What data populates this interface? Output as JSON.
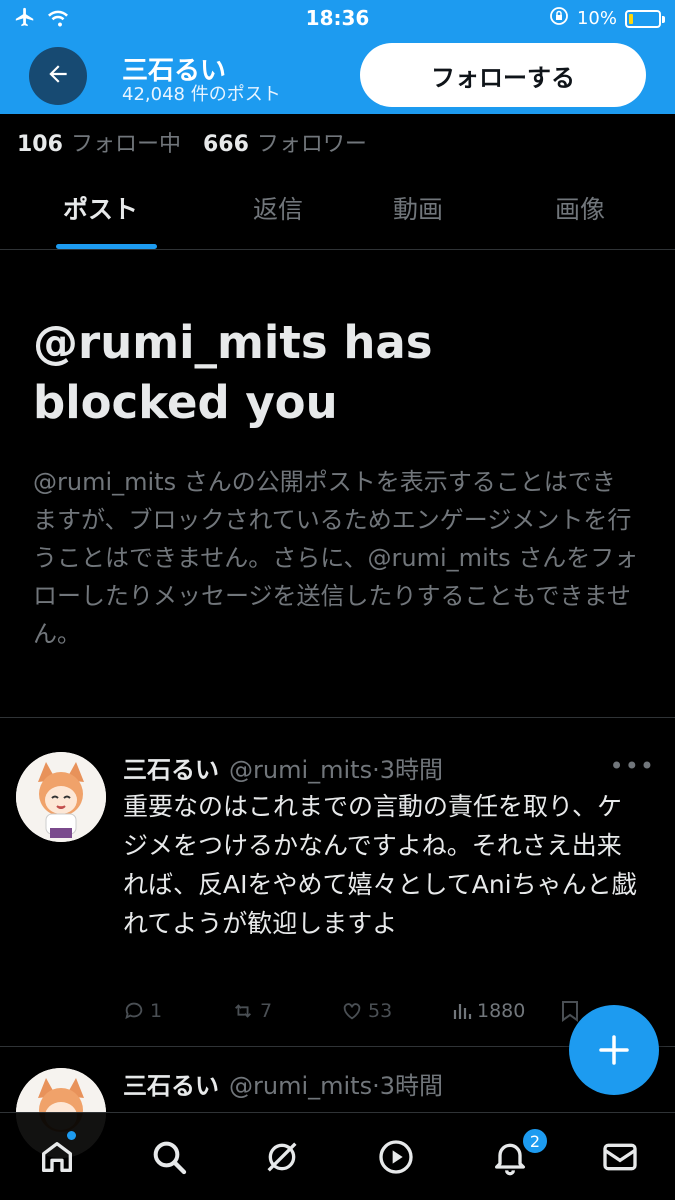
{
  "status_bar": {
    "time": "18:36",
    "battery": "10%",
    "battery_level": 0.1
  },
  "header": {
    "name": "三石るい",
    "post_count": "42,048 件のポスト",
    "follow_label": "フォローする"
  },
  "stats": {
    "following_count": "106",
    "following_label": "フォロー中",
    "followers_count": "666",
    "followers_label": "フォロワー"
  },
  "tabs": [
    {
      "label": "ポスト",
      "active": true
    },
    {
      "label": "返信",
      "active": false
    },
    {
      "label": "動画",
      "active": false
    },
    {
      "label": "画像",
      "active": false
    }
  ],
  "blocked": {
    "title": "@rumi_mits has blocked you",
    "description": "@rumi_mits さんの公開ポストを表示することはできますが、ブロックされているためエンゲージメントを行うことはできません。さらに、@rumi_mits さんをフォローしたりメッセージを送信したりすることもできません。"
  },
  "posts": [
    {
      "name": "三石るい",
      "handle": "@rumi_mits",
      "time": "3時間",
      "text": "重要なのはこれまでの言動の責任を取り、ケジメをつけるかなんですよね。それさえ出来れば、反AIをやめて嬉々としてAniちゃんと戯れてようが歓迎しますよ",
      "replies": "1",
      "reposts": "7",
      "likes": "53",
      "views": "1880"
    },
    {
      "name": "三石るい",
      "handle": "@rumi_mits",
      "time": "3時間"
    }
  ],
  "nav": {
    "notifications_badge": "2"
  },
  "colors": {
    "accent": "#1d9bf0",
    "background": "#000000",
    "text_primary": "#e7e9ea",
    "text_secondary": "#71767b"
  }
}
